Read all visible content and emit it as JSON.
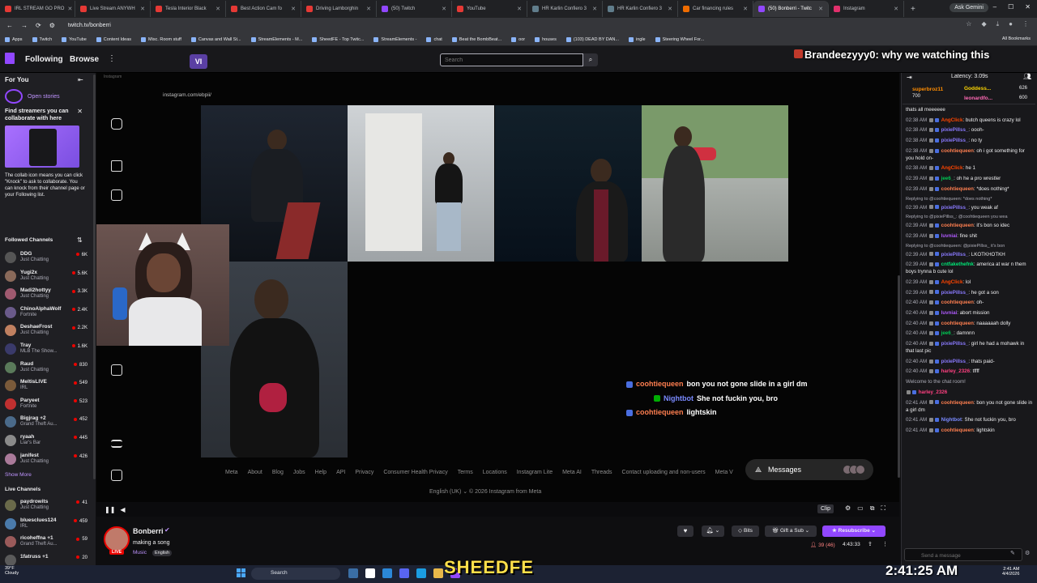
{
  "browser": {
    "tabs": [
      {
        "label": "IRL STREAM GO PRO",
        "color": "#e53935"
      },
      {
        "label": "Live Stream ANYWH",
        "color": "#e53935"
      },
      {
        "label": "Tesla Interior Black",
        "color": "#e53935"
      },
      {
        "label": "Best Action Cam fo",
        "color": "#e53935"
      },
      {
        "label": "Driving Lamborghin",
        "color": "#e53935"
      },
      {
        "label": "(50) Twitch",
        "color": "#9147ff"
      },
      {
        "label": "YouTube",
        "color": "#e53935"
      },
      {
        "label": "HR Karlin Confiero 3",
        "color": "#607d8b"
      },
      {
        "label": "HR Karlin Confiero 3",
        "color": "#607d8b"
      },
      {
        "label": "Car financing rules",
        "color": "#ef6c00"
      },
      {
        "label": "(50) Bonberri - Twitc",
        "color": "#9147ff",
        "active": true
      },
      {
        "label": "Instagram",
        "color": "#e1306c"
      }
    ],
    "ask_gemini": "Ask Gemini",
    "url": "twitch.tv/bonberri",
    "bookmarks": [
      "Apps",
      "Twitch",
      "YouTube",
      "Content Ideas",
      "Misc. Room stuff",
      "Canvas and Wall St...",
      "StreamElements - M...",
      "SheedFE - Top Twitc...",
      "StreamElements -",
      "chat",
      "Beat the BombBeat...",
      "oor",
      "houses",
      "(103) DEAD BY DAN...",
      "ingle",
      "Steering Wheel For..."
    ],
    "all_bookmarks": "All Bookmarks"
  },
  "twitch_nav": {
    "following": "Following",
    "browse": "Browse",
    "vi_logo": "VI",
    "search_placeholder": "Search"
  },
  "overlay_chat": {
    "user": "Brandeezyyy0",
    "message": "why we watching this"
  },
  "sidebar": {
    "for_you": "For You",
    "open_stories": "Open stories",
    "collab_title": "Find streamers you can collaborate with here",
    "collab_body": "The collab icon means you can click \"Knock\" to ask to collaborate. You can knock from their channel page or your Following list.",
    "followed_heading": "Followed Channels",
    "followed": [
      {
        "name": "DDG",
        "category": "Just Chatting",
        "viewers": "6K",
        "color": "#555"
      },
      {
        "name": "Yugi2x",
        "category": "Just Chatting",
        "viewers": "5.6K",
        "color": "#8a6a5a"
      },
      {
        "name": "Madi2hottyy",
        "category": "Just Chatting",
        "viewers": "3.3K",
        "color": "#a05a70"
      },
      {
        "name": "ChinoAlphaWolf",
        "category": "Fortnite",
        "viewers": "2.4K",
        "color": "#6a5a8a"
      },
      {
        "name": "DeshaeFrost",
        "category": "Just Chatting",
        "viewers": "2.2K",
        "color": "#c08060"
      },
      {
        "name": "Tray",
        "category": "MLB The Show...",
        "viewers": "1.6K",
        "color": "#3a3a6a"
      },
      {
        "name": "Raud",
        "category": "Just Chatting",
        "viewers": "830",
        "color": "#5a7a5a"
      },
      {
        "name": "MeltisLIVE",
        "category": "IRL",
        "viewers": "549",
        "color": "#7a5a3a"
      },
      {
        "name": "Paryeet",
        "category": "Fortnite",
        "viewers": "523",
        "color": "#c03030"
      },
      {
        "name": "Bigjrag +2",
        "category": "Grand Theft Au...",
        "viewers": "452",
        "color": "#4a6a8a"
      },
      {
        "name": "ryaah",
        "category": "Liar's Bar",
        "viewers": "445",
        "color": "#8a8a8a"
      },
      {
        "name": "janifest",
        "category": "Just Chatting",
        "viewers": "426",
        "color": "#aa7a9a"
      }
    ],
    "show_more": "Show More",
    "live_heading": "Live Channels",
    "live": [
      {
        "name": "paydrowits",
        "category": "Just Chatting",
        "viewers": "41",
        "color": "#6a6a4a"
      },
      {
        "name": "bluesclues124",
        "category": "IRL",
        "viewers": "459",
        "color": "#4a7aaa"
      },
      {
        "name": "ricoheffna +1",
        "category": "Grand Theft Au...",
        "viewers": "59",
        "color": "#9a5a5a"
      },
      {
        "name": "1fatruss +1",
        "category": "",
        "viewers": "20",
        "color": "#5a5a5a"
      }
    ]
  },
  "video": {
    "inner_tab": "Instagram",
    "inner_url": "instagram.com/ebpii/",
    "overlay_messages": [
      {
        "user": "coohtiequeen",
        "text": "bon you not gone slide in a girl dm",
        "color": "#ff7f50",
        "badge": "#4a6ee0"
      },
      {
        "user": "Nightbot",
        "text": "She not fuckin you, bro",
        "color": "#7a8aff",
        "badge": "#00ad03"
      },
      {
        "user": "coohtiequeen",
        "text": "lightskin",
        "color": "#ff7f50",
        "badge": "#4a6ee0"
      }
    ],
    "footer_links": [
      "Meta",
      "About",
      "Blog",
      "Jobs",
      "Help",
      "API",
      "Privacy",
      "Consumer Health Privacy",
      "Terms",
      "Locations",
      "Instagram Lite",
      "Meta AI",
      "Threads",
      "Contact uploading and non-users",
      "Meta V"
    ],
    "copyright": "English (UK) ⌄   © 2026 Instagram from Meta",
    "messages_label": "Messages",
    "clip": "Clip"
  },
  "stream_info": {
    "streamer": "Bonberri",
    "title": "making a song",
    "category": "Music",
    "language": "English",
    "live_badge": "LIVE",
    "bits": "Bits",
    "gift_sub": "Gift a Sub",
    "resubscribe": "Resubscribe",
    "viewers": "39 (46)",
    "uptime": "4:43:33"
  },
  "chat": {
    "latency": "Latency: 3.09s",
    "leaderboard": [
      {
        "name": "superbroz11",
        "value": "700",
        "color": "#ff8c00"
      },
      {
        "name": "Goddess...",
        "value": "626",
        "color": "#ffd700"
      },
      {
        "name": "leonardfo...",
        "value": "600",
        "color": "#ff69b4"
      }
    ],
    "messages": [
      {
        "time": "",
        "user": "",
        "text": "thats all meeeeee",
        "color": "#efeff1"
      },
      {
        "time": "02:38 AM",
        "user": "AngClick",
        "text": "butch queens is crazy lol",
        "color": "#ff4500"
      },
      {
        "time": "02:38 AM",
        "user": "pixiePillss_",
        "text": "oooh-",
        "color": "#8a7aff"
      },
      {
        "time": "02:38 AM",
        "user": "pixiePillss_",
        "text": "no ty",
        "color": "#8a7aff"
      },
      {
        "time": "02:38 AM",
        "user": "coohtiequeen",
        "text": "oh i got something for you hold on-",
        "color": "#ff7f50"
      },
      {
        "time": "02:38 AM",
        "user": "AngClick",
        "text": "he 1",
        "color": "#ff4500"
      },
      {
        "time": "02:39 AM",
        "user": "jee6_",
        "text": "oh he a pro wrestler",
        "color": "#00c853"
      },
      {
        "time": "02:39 AM",
        "user": "coohtiequeen",
        "text": "*does nothing*",
        "color": "#ff7f50"
      },
      {
        "reply": "Replying to @coohtiequeen: *does nothing*"
      },
      {
        "time": "02:39 AM",
        "user": "pixiePillss_",
        "text": "you weak af",
        "color": "#8a7aff"
      },
      {
        "reply": "Replying to @pixiePillss_: @coohtiequeen you wea"
      },
      {
        "time": "02:39 AM",
        "user": "coohtiequeen",
        "text": "it's bon so idec",
        "color": "#ff7f50"
      },
      {
        "time": "02:39 AM",
        "user": "luvniai",
        "text": "fine shit",
        "color": "#b05aff"
      },
      {
        "reply": "Replying to @coohtiequeen: @pixiePillss_ it's bon"
      },
      {
        "time": "02:39 AM",
        "user": "pixiePillss_",
        "text": "LKOTKHOTKH",
        "color": "#8a7aff"
      },
      {
        "time": "02:39 AM",
        "user": "cntfakethefnk",
        "text": "america at war n them boys trynna b cute lol",
        "color": "#00e676"
      },
      {
        "time": "02:39 AM",
        "user": "AngClick",
        "text": "lol",
        "color": "#ff4500"
      },
      {
        "time": "02:39 AM",
        "user": "pixiePillss_",
        "text": "he got a son",
        "color": "#8a7aff"
      },
      {
        "time": "02:40 AM",
        "user": "coohtiequeen",
        "text": "oh-",
        "color": "#ff7f50"
      },
      {
        "time": "02:40 AM",
        "user": "luvniai",
        "text": "abort mission",
        "color": "#b05aff"
      },
      {
        "time": "02:40 AM",
        "user": "coohtiequeen",
        "text": "naaaaaah dolly",
        "color": "#ff7f50"
      },
      {
        "time": "02:40 AM",
        "user": "jee6_",
        "text": "damnnn",
        "color": "#00c853"
      },
      {
        "time": "02:40 AM",
        "user": "pixiePillss_",
        "text": "girl he had a mohawk in that last pic",
        "color": "#8a7aff"
      },
      {
        "time": "02:40 AM",
        "user": "pixiePillss_",
        "text": "thats paid-",
        "color": "#8a7aff"
      },
      {
        "time": "02:40 AM",
        "user": "harley_2326",
        "text": "tffff",
        "color": "#ff4081"
      },
      {
        "system": "Welcome to the chat room!"
      },
      {
        "time": "",
        "user": "harley_2326",
        "text": "",
        "color": "#ff4081"
      },
      {
        "time": "02:41 AM",
        "user": "coohtiequeen",
        "text": "bon you not gone slide in a girl dm",
        "color": "#ff7f50"
      },
      {
        "time": "02:41 AM",
        "user": "Nightbot",
        "text": "She not fuckin you, bro",
        "color": "#7a8aff"
      },
      {
        "time": "02:41 AM",
        "user": "coohtiequeen",
        "text": "lightskin",
        "color": "#ff7f50"
      }
    ],
    "input_placeholder": "Send a message"
  },
  "taskbar": {
    "weather_temp": "39°F",
    "weather_desc": "Cloudy",
    "search": "Search",
    "overlay_name": "SHEEDFE",
    "clock": "2:41:25 AM",
    "time": "2:41 AM",
    "date": "4/4/2026"
  }
}
